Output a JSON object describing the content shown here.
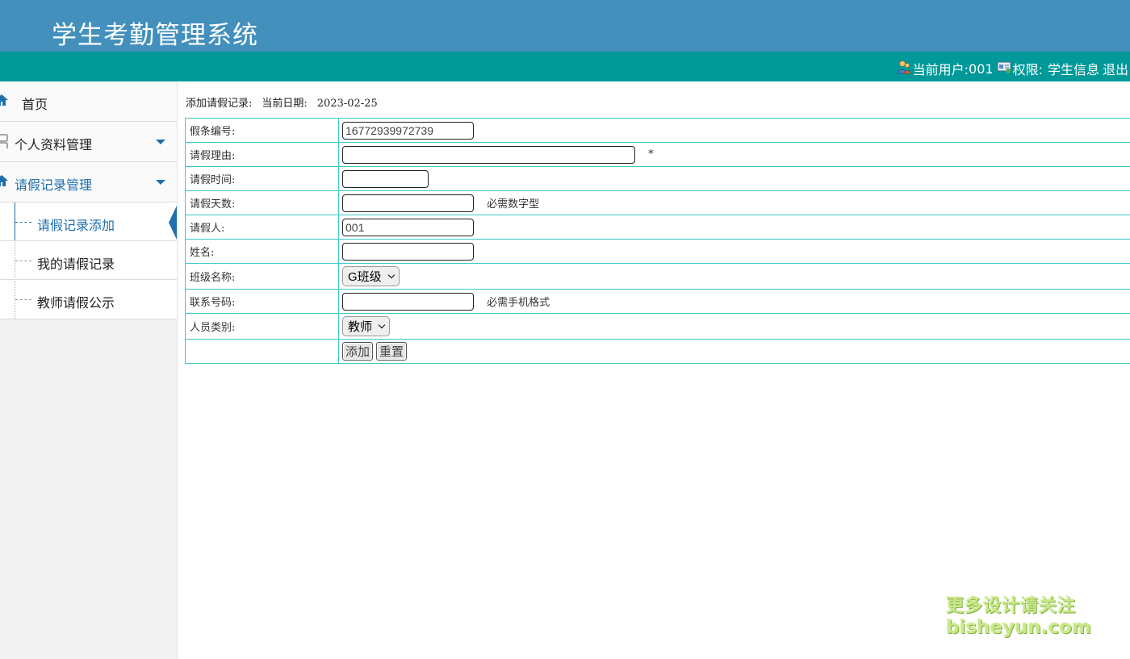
{
  "header": {
    "title": "学生考勤管理系统",
    "user_label": "当前用户:",
    "user_value": "001",
    "role_label": "权限:",
    "role_value": "学生信息",
    "logout": "退出"
  },
  "sidebar": {
    "items": [
      {
        "label": "首页",
        "icon": "home-icon"
      },
      {
        "label": "个人资料管理",
        "icon": "profile-icon"
      },
      {
        "label": "请假记录管理",
        "icon": "home-icon"
      }
    ],
    "sub_items": [
      {
        "label": "请假记录添加"
      },
      {
        "label": "我的请假记录"
      },
      {
        "label": "教师请假公示"
      }
    ]
  },
  "main": {
    "crumb_title": "添加请假记录:",
    "crumb_date_label": "当前日期:",
    "crumb_date": "2023-02-25",
    "form": {
      "leave_no_label": "假条编号:",
      "leave_no_value": "16772939972739",
      "reason_label": "请假理由:",
      "reason_required": "*",
      "time_label": "请假时间:",
      "days_label": "请假天数:",
      "days_note": "必需数字型",
      "applicant_label": "请假人:",
      "applicant_value": "001",
      "name_label": "姓名:",
      "class_label": "班级名称:",
      "class_value": "G班级",
      "phone_label": "联系号码:",
      "phone_note": "必需手机格式",
      "type_label": "人员类别:",
      "type_value": "教师",
      "add_button": "添加",
      "reset_button": "重置"
    }
  },
  "watermark": {
    "line1": "更多设计请关注",
    "line2": "bisheyun.com"
  },
  "colors": {
    "banner": "#4390bd",
    "user_bar": "#009999",
    "accent": "#1e6fae",
    "table_border": "#3cc8c8"
  }
}
